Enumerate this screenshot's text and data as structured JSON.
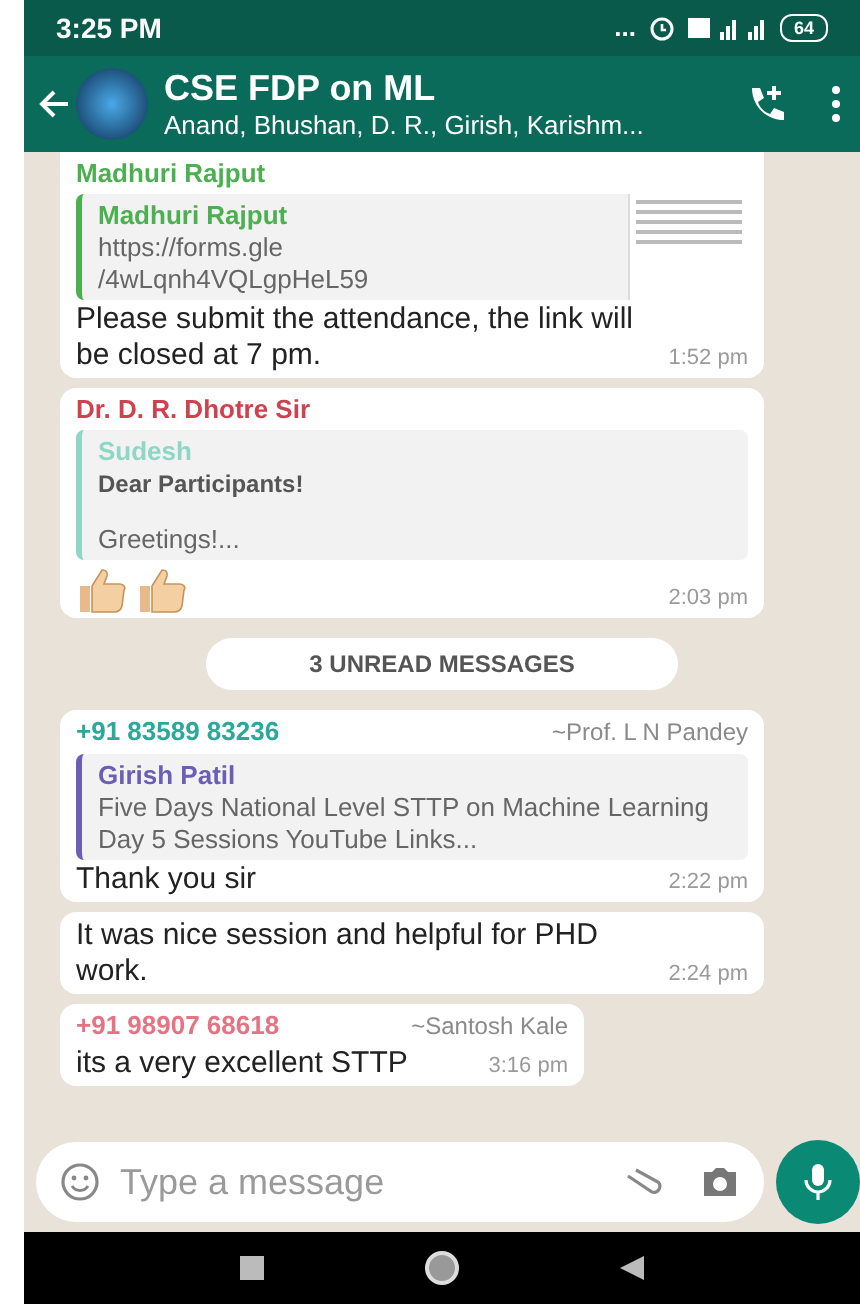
{
  "status_bar": {
    "time": "3:25 PM",
    "dots": "...",
    "battery": "64"
  },
  "header": {
    "title": "CSE FDP on ML",
    "subtitle": "Anand, Bhushan, D. R., Girish, Karishm..."
  },
  "messages": [
    {
      "kind": "link",
      "sender": "Madhuri Rajput",
      "color": "#4caf50",
      "quote": {
        "author": "Madhuri Rajput",
        "color": "#4caf50",
        "lines": [
          "https://forms.gle",
          "/4wLqnh4VQLgpHeL59"
        ]
      },
      "text": "Please submit the attendance, the link will be closed at 7 pm.",
      "time": "1:52 pm"
    },
    {
      "kind": "quote",
      "sender": "Dr. D. R. Dhotre Sir",
      "color": "#d0404f",
      "quote": {
        "author": "Sudesh",
        "color": "#8fd6c4",
        "heading": "Dear Participants!",
        "lines": [
          "Greetings!..."
        ]
      },
      "emoji": true,
      "time": "2:03 pm"
    },
    {
      "kind": "divider",
      "text": "3 UNREAD MESSAGES"
    },
    {
      "kind": "quote",
      "sender": "+91 83589 83236",
      "color": "#2aa89a",
      "alias": "~Prof. L N Pandey",
      "quote": {
        "author": "Girish Patil",
        "color": "#6b5fb5",
        "lines": [
          "Five Days National Level STTP on Machine Learning",
          "Day 5 Sessions YouTube Links..."
        ]
      },
      "text": "Thank you sir",
      "time": "2:22 pm"
    },
    {
      "kind": "text",
      "text": "It was nice session and helpful for PHD work.",
      "time": "2:24 pm"
    },
    {
      "kind": "text",
      "sender": "+91 98907 68618",
      "color": "#e57383",
      "alias": "~Santosh Kale",
      "text": "its a very excellent STTP",
      "time": "3:16 pm"
    }
  ],
  "composer": {
    "placeholder": "Type a message"
  }
}
